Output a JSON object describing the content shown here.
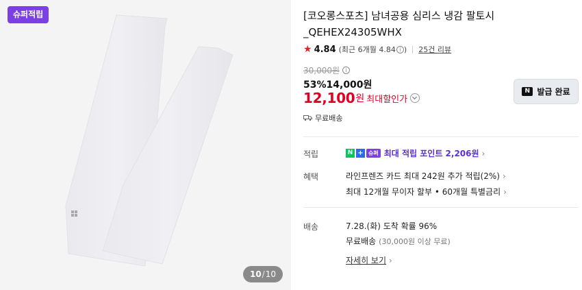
{
  "image": {
    "badge": "슈퍼적립",
    "counter": {
      "current": "10",
      "separator": "/",
      "total": "10"
    }
  },
  "product": {
    "title": "[코오롱스포츠] 남녀공용 심리스 냉감 팔토시 _QEHEX24305WHX",
    "rating": "4.84",
    "rating_detail": "(최근 6개월 4.84",
    "rating_detail_close": ")",
    "reviews": "25건 리뷰"
  },
  "price": {
    "original": "30,000원",
    "discount_percent": "53%",
    "sale_price": "14,000원",
    "max_price": "12,100",
    "max_unit": "원",
    "max_label": "최대할인가"
  },
  "coupon_button": {
    "label": "발급 완료",
    "icon_text": "N"
  },
  "shipping_summary": "무료배송",
  "points": {
    "label": "적립",
    "icons": {
      "n": "N",
      "plus": "+",
      "super": "슈퍼"
    },
    "text": "최대 적립 포인트 2,206원"
  },
  "benefits": {
    "label": "혜택",
    "items": [
      "라인프렌즈 카드 최대 242원 추가 적립(2%)",
      "최대 12개월 무이자 할부 • 60개월 특별금리"
    ]
  },
  "delivery": {
    "label": "배송",
    "arrival": "7.28.(화) 도착 확률 96%",
    "free_shipping": "무료배송",
    "free_condition": "(30,000원 이상 무료)",
    "details_link": "자세히 보기"
  },
  "colors": {
    "accent_purple": "#7b3fe4",
    "price_red": "#e10024",
    "star_red": "#e5202e",
    "naver_green": "#03c75a"
  }
}
